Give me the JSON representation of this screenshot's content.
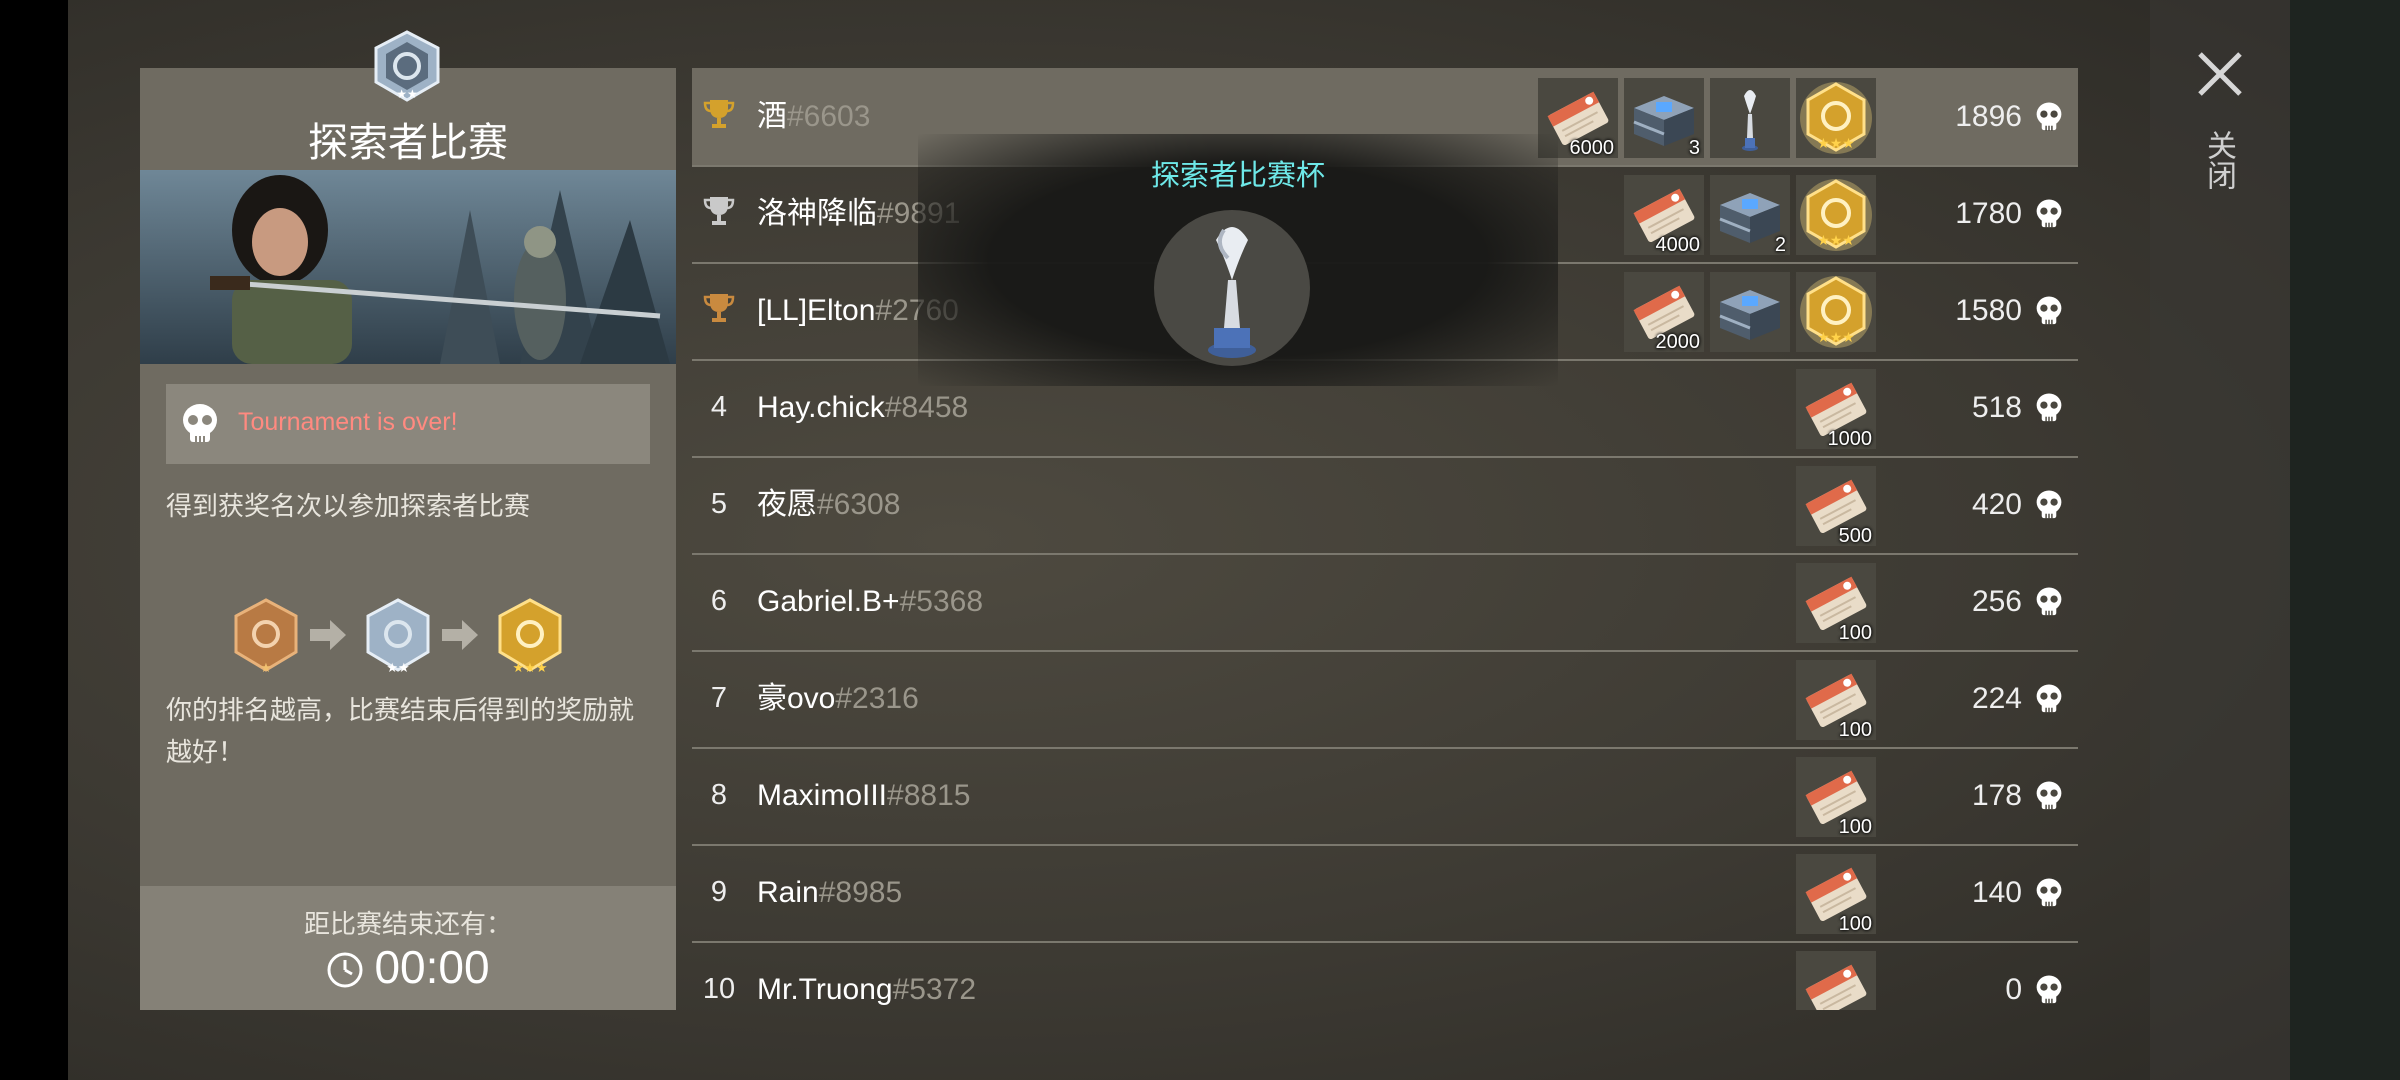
{
  "panel": {
    "title": "探索者比赛",
    "status_text": "Tournament is over!",
    "description": "得到获奖名次以参加探索者比赛",
    "reward_text": "你的排名越高，比赛结束后得到的奖励就越好！",
    "timer_label": "距比赛结束还有：",
    "timer_value": "00:00"
  },
  "tooltip": {
    "title": "探索者比赛杯"
  },
  "close_label": "关闭",
  "leaderboard": [
    {
      "rank": "",
      "trophy": "gold",
      "name": "酒",
      "tag": "#6603",
      "score": "1896",
      "rewards": [
        {
          "type": "ticket",
          "count": "6000"
        },
        {
          "type": "crate",
          "count": "3"
        },
        {
          "type": "cup",
          "count": ""
        },
        {
          "type": "medal-gold",
          "count": ""
        }
      ]
    },
    {
      "rank": "",
      "trophy": "silver",
      "name": "洛神降临",
      "tag": "#9891",
      "score": "1780",
      "rewards": [
        {
          "type": "ticket",
          "count": "4000"
        },
        {
          "type": "crate",
          "count": "2"
        },
        {
          "type": "medal-gold",
          "count": ""
        }
      ]
    },
    {
      "rank": "",
      "trophy": "bronze",
      "name": "[LL]Elton",
      "tag": "#2760",
      "score": "1580",
      "rewards": [
        {
          "type": "ticket",
          "count": "2000"
        },
        {
          "type": "crate",
          "count": ""
        },
        {
          "type": "medal-gold",
          "count": ""
        }
      ]
    },
    {
      "rank": "4",
      "trophy": "",
      "name": "Hay.chick",
      "tag": "#8458",
      "score": "518",
      "rewards": [
        {
          "type": "ticket",
          "count": "1000"
        }
      ]
    },
    {
      "rank": "5",
      "trophy": "",
      "name": "夜愿",
      "tag": "#6308",
      "score": "420",
      "rewards": [
        {
          "type": "ticket",
          "count": "500"
        }
      ]
    },
    {
      "rank": "6",
      "trophy": "",
      "name": "Gabriel.B+",
      "tag": "#5368",
      "score": "256",
      "rewards": [
        {
          "type": "ticket",
          "count": "100"
        }
      ]
    },
    {
      "rank": "7",
      "trophy": "",
      "name": "豪ovo",
      "tag": "#2316",
      "score": "224",
      "rewards": [
        {
          "type": "ticket",
          "count": "100"
        }
      ]
    },
    {
      "rank": "8",
      "trophy": "",
      "name": "MaximoIII",
      "tag": "#8815",
      "score": "178",
      "rewards": [
        {
          "type": "ticket",
          "count": "100"
        }
      ]
    },
    {
      "rank": "9",
      "trophy": "",
      "name": "Rain",
      "tag": "#8985",
      "score": "140",
      "rewards": [
        {
          "type": "ticket",
          "count": "100"
        }
      ]
    },
    {
      "rank": "10",
      "trophy": "",
      "name": "Mr.Truong",
      "tag": "#5372",
      "score": "0",
      "rewards": [
        {
          "type": "ticket",
          "count": ""
        }
      ]
    }
  ],
  "colors": {
    "status": "#ff8a80",
    "tooltip_title": "#6ee8e8",
    "gold": "#d4a12c",
    "silver": "#c9c9c9",
    "bronze": "#c98a3f"
  }
}
